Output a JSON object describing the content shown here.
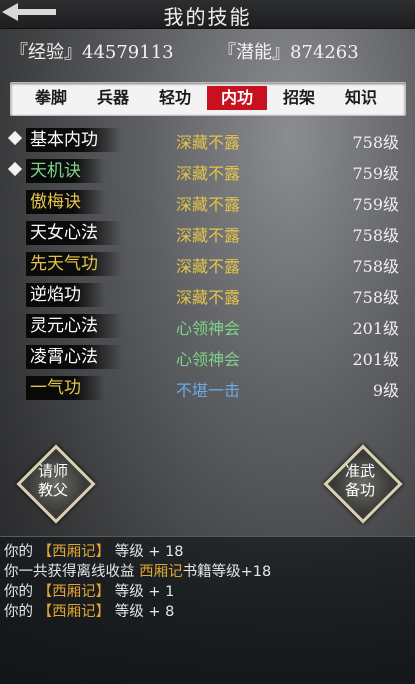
{
  "header": {
    "title": "我的技能",
    "back_icon": "back-arrow-icon"
  },
  "stats": {
    "experience": "『经验』44579113",
    "potential": "『潜能』874263"
  },
  "tabs": [
    {
      "label": "拳脚"
    },
    {
      "label": "兵器"
    },
    {
      "label": "轻功"
    },
    {
      "label": "内功"
    },
    {
      "label": "招架"
    },
    {
      "label": "知识"
    }
  ],
  "active_tab_index": 3,
  "colors": {
    "accent_red": "#c8101e",
    "gold": "#e4c54a",
    "green": "#7fd48a",
    "blue": "#6fa7e6",
    "log_highlight": "#e2a535"
  },
  "skills": [
    {
      "name": "基本内功",
      "level_text": "深藏不露",
      "grade": "758级"
    },
    {
      "name": "天机诀",
      "level_text": "深藏不露",
      "grade": "759级"
    },
    {
      "name": "傲梅诀",
      "level_text": "深藏不露",
      "grade": "759级"
    },
    {
      "name": "天女心法",
      "level_text": "深藏不露",
      "grade": "758级"
    },
    {
      "name": "先天气功",
      "level_text": "深藏不露",
      "grade": "758级"
    },
    {
      "name": "逆焰功",
      "level_text": "深藏不露",
      "grade": "758级"
    },
    {
      "name": "灵元心法",
      "level_text": "心领神会",
      "grade": "201级"
    },
    {
      "name": "凌霄心法",
      "level_text": "心领神会",
      "grade": "201级"
    },
    {
      "name": "一气功",
      "level_text": "不堪一击",
      "grade": "9级"
    }
  ],
  "buttons": {
    "left_line1": "请师",
    "left_line2": "教父",
    "right_line1": "准武",
    "right_line2": "备功"
  },
  "log": [
    {
      "pre": "你的 ",
      "hl": "【西厢记】",
      "post": " 等级 + 18"
    },
    {
      "pre": "你一共获得离线收益 ",
      "hl": "西厢记",
      "post": "书籍等级+18"
    },
    {
      "pre": "你的 ",
      "hl": "【西厢记】",
      "post": " 等级 + 1"
    },
    {
      "pre": "你的 ",
      "hl": "【西厢记】",
      "post": " 等级 + 8"
    }
  ]
}
